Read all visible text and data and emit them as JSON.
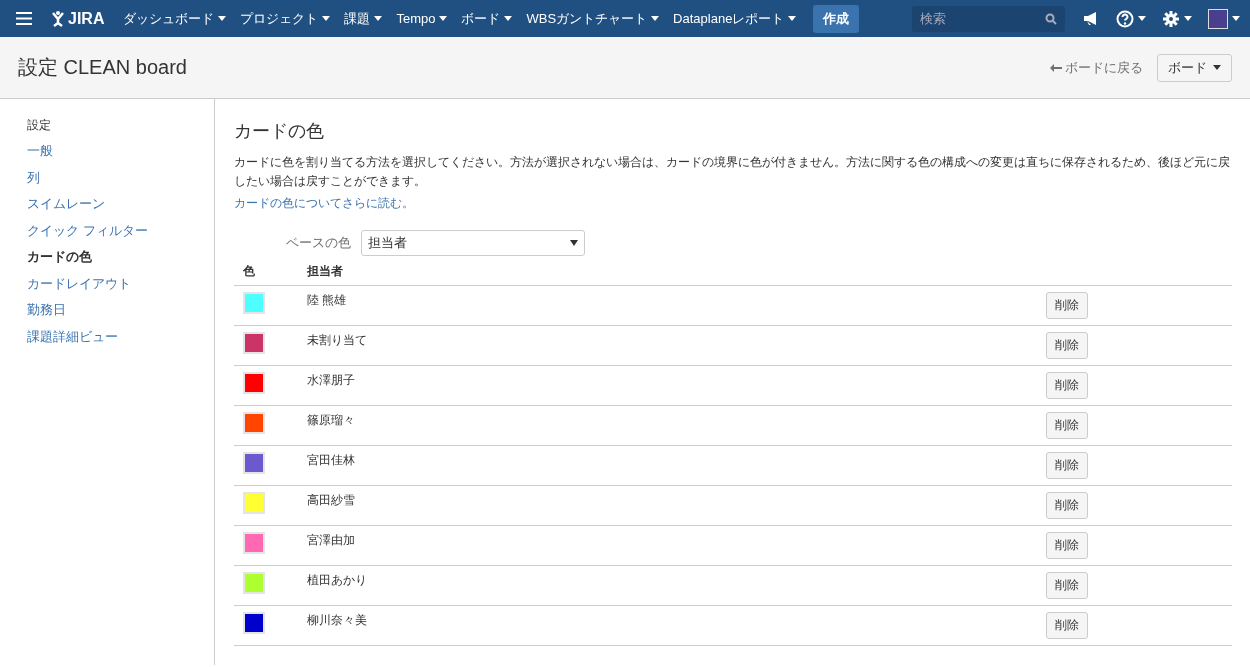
{
  "topbar": {
    "logo": "JIRA",
    "menus": [
      {
        "label": "ダッシュボード"
      },
      {
        "label": "プロジェクト"
      },
      {
        "label": "課題"
      },
      {
        "label": "Tempo"
      },
      {
        "label": "ボード"
      },
      {
        "label": "WBSガントチャート"
      },
      {
        "label": "Dataplaneレポート"
      }
    ],
    "create_button": "作成",
    "search": {
      "placeholder": "検索"
    }
  },
  "page_header": {
    "title": "設定 CLEAN board",
    "back_link": "ボードに戻る",
    "board_button": "ボード"
  },
  "sidebar": {
    "heading": "設定",
    "items": [
      {
        "label": "一般",
        "selected": false
      },
      {
        "label": "列",
        "selected": false
      },
      {
        "label": "スイムレーン",
        "selected": false
      },
      {
        "label": "クイック フィルター",
        "selected": false
      },
      {
        "label": "カードの色",
        "selected": true
      },
      {
        "label": "カードレイアウト",
        "selected": false
      },
      {
        "label": "勤務日",
        "selected": false
      },
      {
        "label": "課題詳細ビュー",
        "selected": false
      }
    ]
  },
  "content": {
    "title": "カードの色",
    "description": "カードに色を割り当てる方法を選択してください。方法が選択されない場合は、カードの境界に色が付きません。方法に関する色の構成への変更は直ちに保存されるため、後ほど元に戻したい場合は戻すことができます。",
    "link": "カードの色についてさらに読む。",
    "base_color": {
      "label": "ベースの色",
      "value": "担当者"
    },
    "table": {
      "columns": [
        "色",
        "担当者"
      ],
      "rows": [
        {
          "name": "陸 熊雄",
          "color": "#4dffff",
          "action": "削除"
        },
        {
          "name": "未割り当て",
          "color": "#cc3366",
          "action": "削除"
        },
        {
          "name": "水澤朋子",
          "color": "#ff0000",
          "action": "削除"
        },
        {
          "name": "篠原瑠々",
          "color": "#ff4500",
          "action": "削除"
        },
        {
          "name": "宮田佳林",
          "color": "#6a5acd",
          "action": "削除"
        },
        {
          "name": "高田紗雪",
          "color": "#ffff33",
          "action": "削除"
        },
        {
          "name": "宮澤由加",
          "color": "#ff69b4",
          "action": "削除"
        },
        {
          "name": "植田あかり",
          "color": "#adff2f",
          "action": "削除"
        },
        {
          "name": "柳川奈々美",
          "color": "#0000cd",
          "action": "削除"
        }
      ]
    }
  }
}
